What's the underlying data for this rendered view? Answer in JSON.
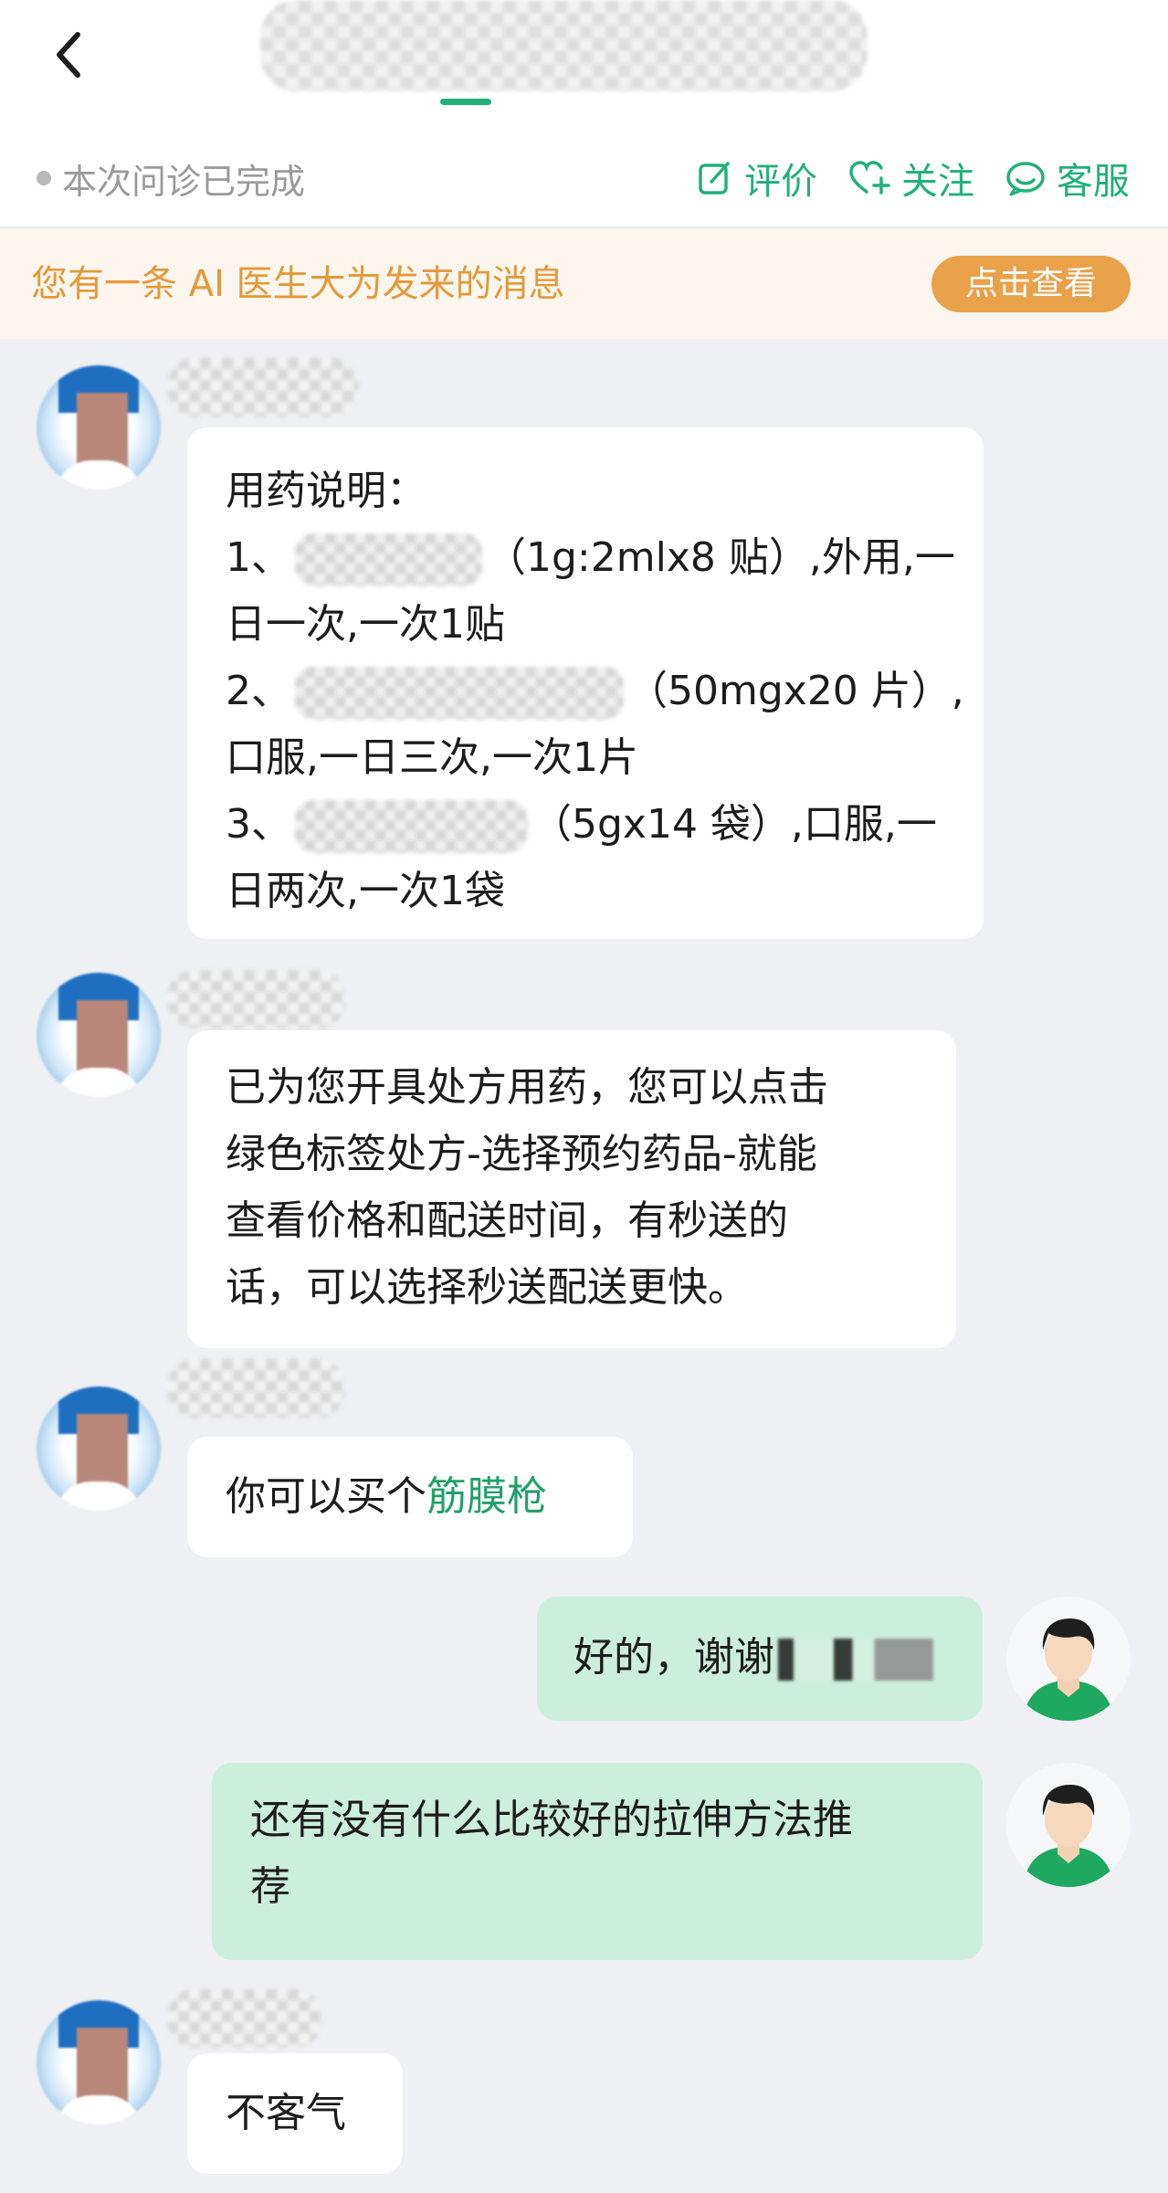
{
  "header": {
    "status_text": "本次问诊已完成",
    "actions": [
      {
        "label": "评价",
        "icon": "edit-icon"
      },
      {
        "label": "关注",
        "icon": "heart-plus-icon"
      },
      {
        "label": "客服",
        "icon": "customer-service-icon"
      }
    ]
  },
  "banner": {
    "text": "您有一条 AI 医生大为发来的消息",
    "button_label": "点击查看"
  },
  "colors": {
    "accent_green": "#22b07a",
    "banner_orange": "#e39a3a",
    "button_orange": "#e9a14a",
    "user_bubble": "#cbeedd"
  },
  "messages": [
    {
      "sender": "doctor",
      "lines": [
        {
          "text": "用药说明："
        },
        {
          "prefix": "1、",
          "suffix": "（1g:2mlx8 贴）,外用,一"
        },
        {
          "text": "日一次,一次1贴"
        },
        {
          "prefix": "2、",
          "suffix": "（50mgx20 片）,"
        },
        {
          "text": "口服,一日三次,一次1片"
        },
        {
          "prefix": "3、",
          "suffix": "（5gx14 袋）,口服,一"
        },
        {
          "text": "日两次,一次1袋"
        }
      ]
    },
    {
      "sender": "doctor",
      "lines": [
        {
          "text": "已为您开具处方用药，您可以点击"
        },
        {
          "text": "绿色标签处方-选择预约药品-就能"
        },
        {
          "text": "查看价格和配送时间，有秒送的"
        },
        {
          "text": "话，可以选择秒送配送更快。"
        }
      ]
    },
    {
      "sender": "doctor",
      "text": "你可以买个",
      "link": "筋膜枪"
    },
    {
      "sender": "user",
      "text": "好的，谢谢"
    },
    {
      "sender": "user",
      "lines": [
        {
          "text": "还有没有什么比较好的拉伸方法推"
        },
        {
          "text": "荐"
        }
      ]
    },
    {
      "sender": "doctor",
      "text": "不客气"
    }
  ]
}
